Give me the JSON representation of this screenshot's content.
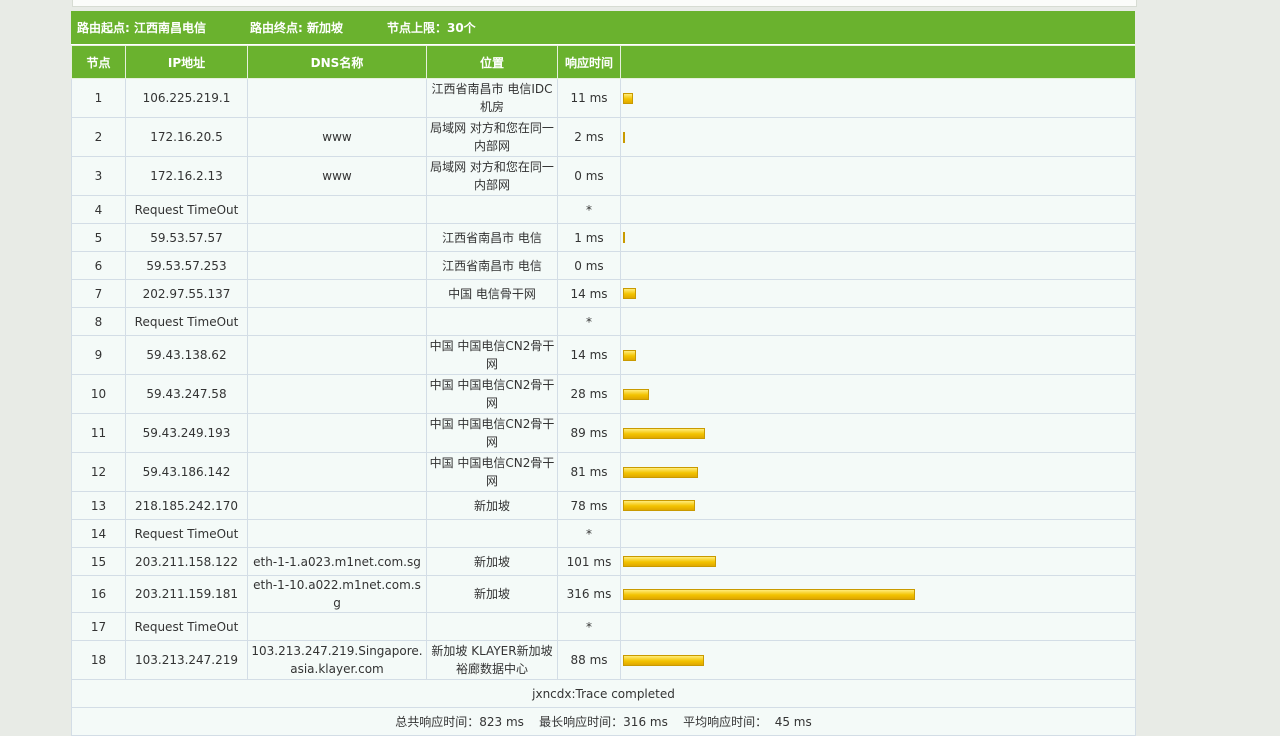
{
  "info": {
    "origin": "路由起点: 江西南昌电信",
    "destination": "路由终点: 新加坡",
    "limit": "节点上限：30个"
  },
  "columns": [
    "节点",
    "IP地址",
    "DNS名称",
    "位置",
    "响应时间"
  ],
  "max_ms": 316,
  "hops": [
    {
      "node": "1",
      "ip": "106.225.219.1",
      "dns": "",
      "location": "江西省南昌市 电信IDC机房",
      "time": "11 ms",
      "ms": 11
    },
    {
      "node": "2",
      "ip": "172.16.20.5",
      "dns": "www",
      "location": "局域网 对方和您在同一内部网",
      "time": "2 ms",
      "ms": 2
    },
    {
      "node": "3",
      "ip": "172.16.2.13",
      "dns": "www",
      "location": "局域网 对方和您在同一内部网",
      "time": "0 ms",
      "ms": 0
    },
    {
      "node": "4",
      "ip": "Request TimeOut",
      "dns": "",
      "location": "",
      "time": "*",
      "ms": null
    },
    {
      "node": "5",
      "ip": "59.53.57.57",
      "dns": "",
      "location": "江西省南昌市 电信",
      "time": "1 ms",
      "ms": 1
    },
    {
      "node": "6",
      "ip": "59.53.57.253",
      "dns": "",
      "location": "江西省南昌市 电信",
      "time": "0 ms",
      "ms": 0
    },
    {
      "node": "7",
      "ip": "202.97.55.137",
      "dns": "",
      "location": "中国 电信骨干网",
      "time": "14 ms",
      "ms": 14
    },
    {
      "node": "8",
      "ip": "Request TimeOut",
      "dns": "",
      "location": "",
      "time": "*",
      "ms": null
    },
    {
      "node": "9",
      "ip": "59.43.138.62",
      "dns": "",
      "location": "中国 中国电信CN2骨干网",
      "time": "14 ms",
      "ms": 14
    },
    {
      "node": "10",
      "ip": "59.43.247.58",
      "dns": "",
      "location": "中国 中国电信CN2骨干网",
      "time": "28 ms",
      "ms": 28
    },
    {
      "node": "11",
      "ip": "59.43.249.193",
      "dns": "",
      "location": "中国 中国电信CN2骨干网",
      "time": "89 ms",
      "ms": 89
    },
    {
      "node": "12",
      "ip": "59.43.186.142",
      "dns": "",
      "location": "中国 中国电信CN2骨干网",
      "time": "81 ms",
      "ms": 81
    },
    {
      "node": "13",
      "ip": "218.185.242.170",
      "dns": "",
      "location": "新加坡",
      "time": "78 ms",
      "ms": 78
    },
    {
      "node": "14",
      "ip": "Request TimeOut",
      "dns": "",
      "location": "",
      "time": "*",
      "ms": null
    },
    {
      "node": "15",
      "ip": "203.211.158.122",
      "dns": "eth-1-1.a023.m1net.com.sg",
      "location": "新加坡",
      "time": "101 ms",
      "ms": 101
    },
    {
      "node": "16",
      "ip": "203.211.159.181",
      "dns": "eth-1-10.a022.m1net.com.sg",
      "location": "新加坡",
      "time": "316 ms",
      "ms": 316
    },
    {
      "node": "17",
      "ip": "Request TimeOut",
      "dns": "",
      "location": "",
      "time": "*",
      "ms": null
    },
    {
      "node": "18",
      "ip": "103.213.247.219",
      "dns": "103.213.247.219.Singapore.asia.klayer.com",
      "location": "新加坡 KLAYER新加坡裕廊数据中心",
      "time": "88 ms",
      "ms": 88
    }
  ],
  "footer": {
    "trace_status": "jxncdx:Trace completed",
    "summary": "总共响应时间：823 ms    最长响应时间：316 ms    平均响应时间：  45 ms"
  },
  "colors": {
    "header_green": "#6ab22e",
    "row_bg": "#f4faf8",
    "bar_yellow": "#f3c300"
  }
}
